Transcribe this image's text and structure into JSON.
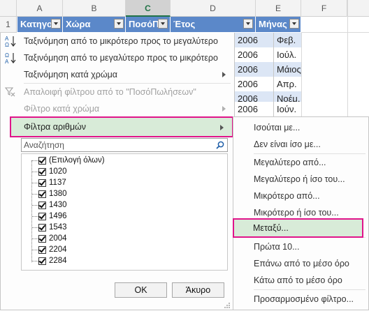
{
  "columns": [
    {
      "letter": "A"
    },
    {
      "letter": "B"
    },
    {
      "letter": "C"
    },
    {
      "letter": "D"
    },
    {
      "letter": "E"
    },
    {
      "letter": "F"
    }
  ],
  "row_number": "1",
  "headers": {
    "category": "Κατηγο",
    "country": "Χώρα",
    "amount": "ΠοσόΠω",
    "year": "Έτος",
    "month": "Μήνας"
  },
  "data_rows": [
    {
      "year": "2006",
      "month": "Φεβ."
    },
    {
      "year": "2006",
      "month": "Ιούλ."
    },
    {
      "year": "2006",
      "month": "Μάιος"
    },
    {
      "year": "2006",
      "month": "Απρ."
    },
    {
      "year": "2006",
      "month": "Νοέμ."
    },
    {
      "year": "2006",
      "month": "Ιούν."
    }
  ],
  "menu": {
    "sort_asc": "Ταξινόμηση από το μικρότερο προς το μεγαλύτερο",
    "sort_desc": "Ταξινόμηση από το μεγαλύτερο προς το μικρότερο",
    "sort_color": "Ταξινόμηση κατά χρώμα",
    "clear_filter": "Απαλοιφή φίλτρου από το \"ΠοσόΠωλήσεων\"",
    "filter_color": "Φίλτρο κατά χρώμα",
    "number_filters": "Φίλτρα αριθμών",
    "search_placeholder": "Αναζήτηση",
    "ok": "OK",
    "cancel": "Άκυρο"
  },
  "list_items": [
    {
      "label": "(Επιλογή όλων)",
      "checked": true
    },
    {
      "label": "1020",
      "checked": true
    },
    {
      "label": "1137",
      "checked": true
    },
    {
      "label": "1380",
      "checked": true
    },
    {
      "label": "1430",
      "checked": true
    },
    {
      "label": "1496",
      "checked": true
    },
    {
      "label": "1543",
      "checked": true
    },
    {
      "label": "2004",
      "checked": true
    },
    {
      "label": "2204",
      "checked": true
    },
    {
      "label": "2284",
      "checked": true
    }
  ],
  "submenu": [
    "Ισούται με...",
    "Δεν είναι ίσο με...",
    "Μεγαλύτερο από...",
    "Μεγαλύτερο ή ίσο του...",
    "Μικρότερο από...",
    "Μικρότερο ή ίσο του...",
    "Μεταξύ...",
    "Πρώτα 10...",
    "Επάνω από το μέσο όρο",
    "Κάτω από το μέσο όρο",
    "Προσαρμοσμένο φίλτρο..."
  ],
  "colors": {
    "header_blue": "#5b88c9",
    "row_blue": "#dce6f5",
    "highlight_green": "#d8ebd8",
    "magenta_outline": "#e0148a"
  }
}
